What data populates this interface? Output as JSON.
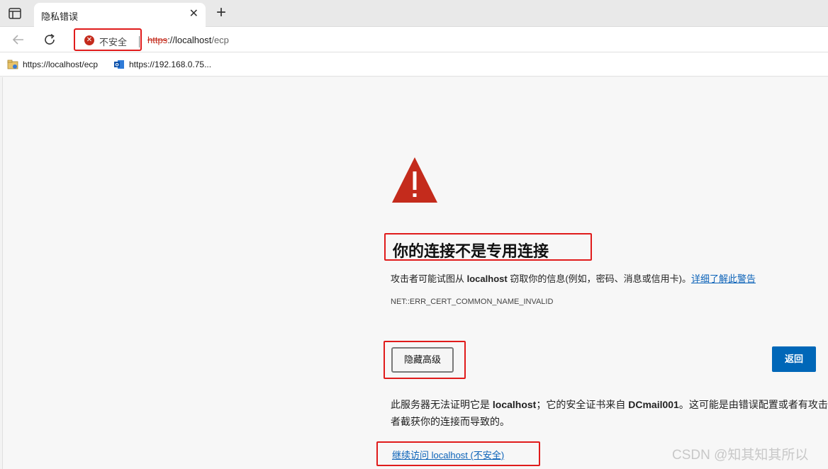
{
  "tab": {
    "title": "隐私错误",
    "close": "✕",
    "new_tab": "+"
  },
  "toolbar": {
    "security_label": "不安全",
    "url_scheme": "https",
    "url_host": "://localhost",
    "url_path": "/ecp"
  },
  "favorites": [
    {
      "label": "https://localhost/ecp",
      "icon": "folder-link-icon"
    },
    {
      "label": "https://192.168.0.75...",
      "icon": "outlook-icon"
    }
  ],
  "page": {
    "headline": "你的连接不是专用连接",
    "desc_before": "攻击者可能试图从 ",
    "desc_host": "localhost",
    "desc_after": " 窃取你的信息(例如，密码、消息或信用卡)。",
    "learn_more": "详细了解此警告",
    "error_code": "NET::ERR_CERT_COMMON_NAME_INVALID",
    "hide_advanced_button": "隐藏高级",
    "back_button": "返回",
    "detail_1": "此服务器无法证明它是 ",
    "detail_host": "localhost",
    "detail_2": "；它的安全证书来自 ",
    "detail_issuer": "DCmail001",
    "detail_3": "。这可能是由错误配置或者有攻击者截获你的连接而导致的。",
    "proceed_link": "继续访问 localhost (不安全)",
    "watermark": "CSDN @知其知其所以"
  },
  "colors": {
    "warning_red": "#c42b1c",
    "link_blue": "#0b62b8",
    "button_blue": "#0067b8",
    "highlight_box": "#e01b1b"
  }
}
